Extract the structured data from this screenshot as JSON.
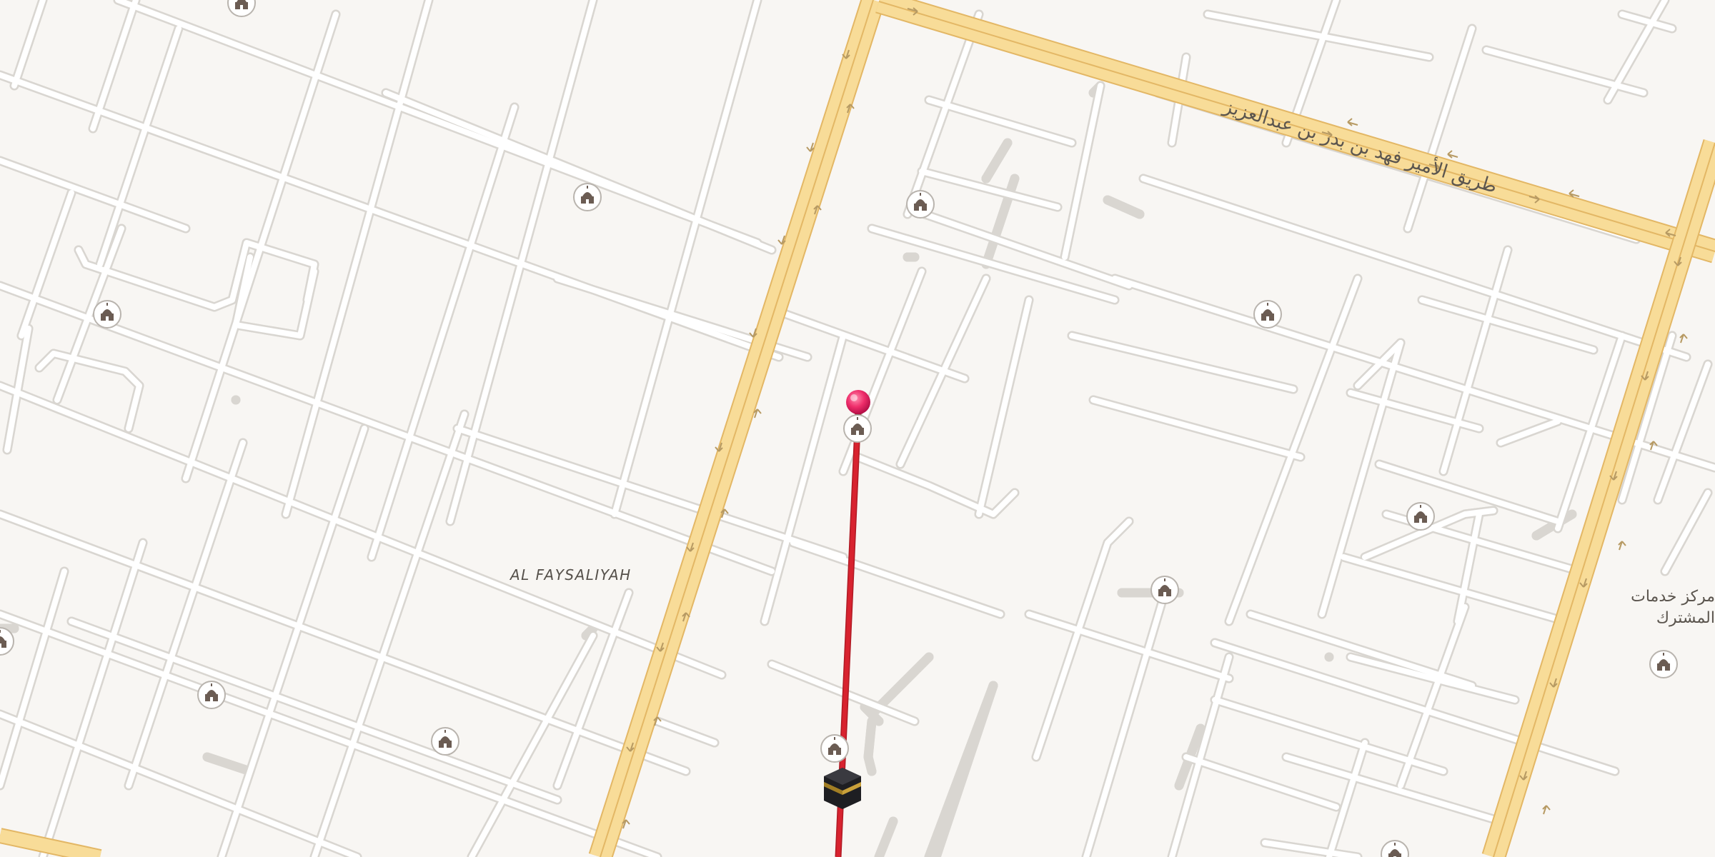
{
  "map": {
    "area_label": "AL FAYSALIYAH",
    "street_label": "طريق الأمير فهد بن بدر بن عبدالعزيز",
    "poi_label_line1": "مركز خدمات",
    "poi_label_line2": "المشترك",
    "colors": {
      "background": "#f8f6f3",
      "minor_road": "#ffffff",
      "minor_road_casing": "#d9d6d1",
      "major_road": "#f8dc98",
      "major_road_casing": "#e3b765",
      "route_line": "#d8232f",
      "pin": "#ee2d6a",
      "mosque_icon": "#6b5c53"
    },
    "icons": {
      "mosque": "mosque-icon",
      "kaaba": "kaaba-icon",
      "pin": "map-pin-icon"
    }
  }
}
